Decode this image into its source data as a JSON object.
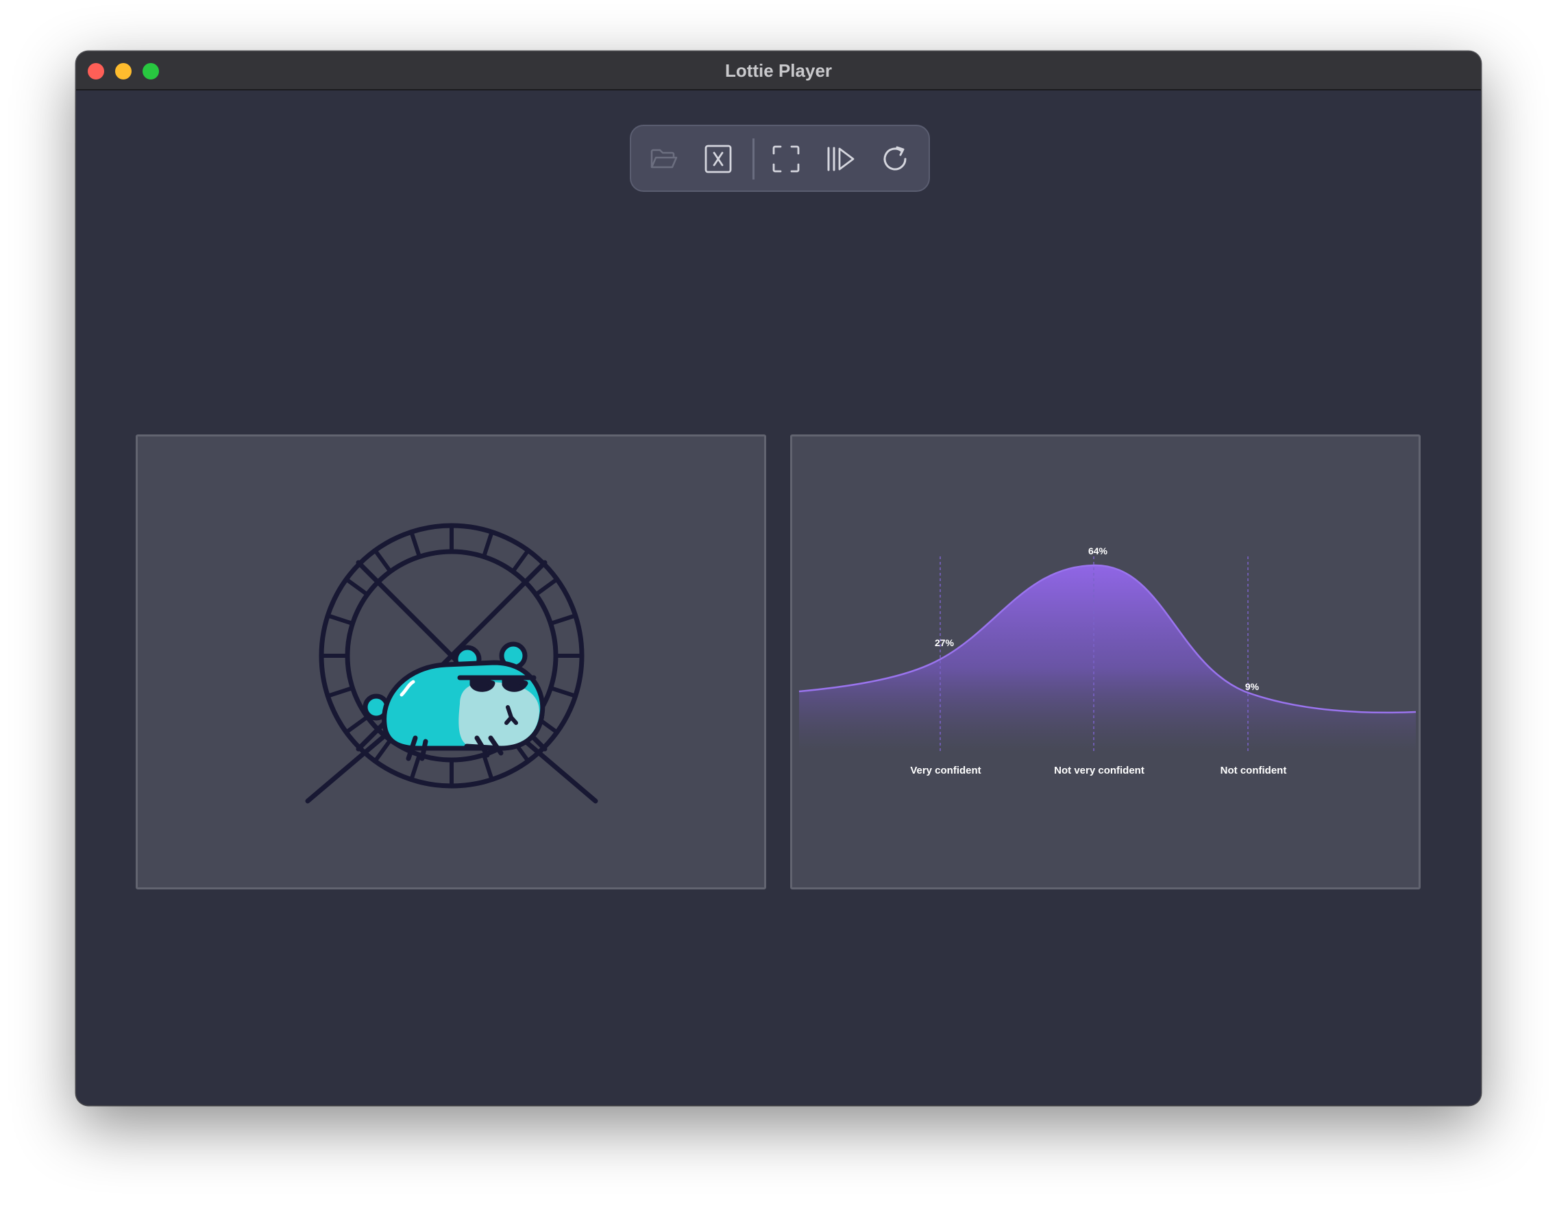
{
  "window": {
    "title": "Lottie Player"
  },
  "toolbar": {
    "buttons": [
      {
        "name": "open-folder-button",
        "icon": "folder-open-icon",
        "enabled": false
      },
      {
        "name": "close-file-button",
        "icon": "close-box-icon",
        "enabled": true
      },
      {
        "name": "fit-screen-button",
        "icon": "fullscreen-icon",
        "enabled": true
      },
      {
        "name": "play-button",
        "icon": "play-pause-icon",
        "enabled": true
      },
      {
        "name": "reload-button",
        "icon": "reload-icon",
        "enabled": true
      }
    ]
  },
  "animations": [
    {
      "name": "hamster-wheel-animation",
      "colors": {
        "body": "#1ac9cf",
        "belly": "#a5dde0",
        "outline": "#181833"
      }
    },
    {
      "name": "confidence-curve-animation"
    }
  ],
  "chart_data": {
    "type": "area",
    "categories": [
      "Very confident",
      "Not very confident",
      "Not confident"
    ],
    "values": [
      27,
      64,
      9
    ],
    "data_labels": [
      "27%",
      "64%",
      "9%"
    ],
    "colors": {
      "fill_top": "#8f67e3",
      "fill_bottom": "#474957",
      "line": "#9a74ee",
      "guide": "#7b62c9",
      "text": "#ffffff"
    }
  }
}
